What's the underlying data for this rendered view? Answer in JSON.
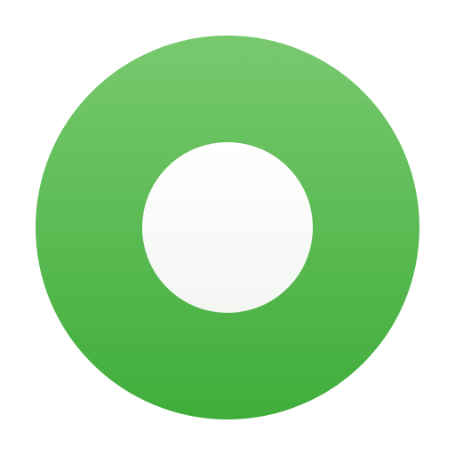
{
  "icon": {
    "name": "record-button-icon",
    "ring_color_top": "#78C96E",
    "ring_color_bottom": "#3FAD3A",
    "center_color_top": "#FFFFFF",
    "center_color_bottom": "#F3F6F2",
    "background_color": "#FFFFFF"
  }
}
